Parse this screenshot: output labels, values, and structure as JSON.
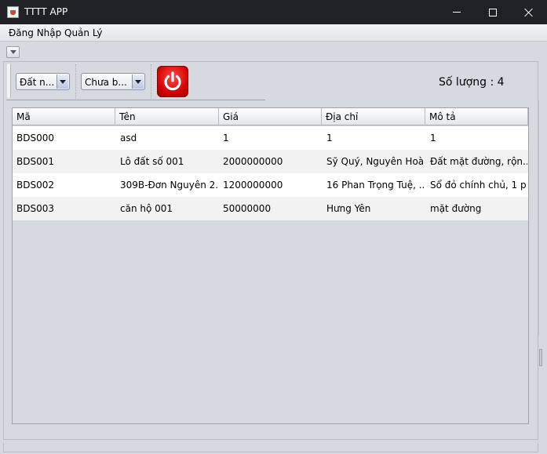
{
  "window": {
    "title": "TTTT APP"
  },
  "menu": {
    "items": [
      "Đăng Nhập",
      "Quản Lý"
    ]
  },
  "toolbar": {
    "combo_type_value": "Đất n...",
    "combo_status_value": "Chưa b...",
    "count_label": "Số lượng : 4"
  },
  "table": {
    "columns": [
      "Mã",
      "Tên",
      "Giá",
      "Địa chỉ",
      "Mô tả"
    ],
    "rows": [
      [
        "BDS000",
        "asd",
        "1",
        "1",
        "1"
      ],
      [
        "BDS001",
        "Lô đất số 001",
        "2000000000",
        "Sỹ Quý, Nguyên Hoà...",
        "Đất mặt đường, rộn..."
      ],
      [
        "BDS002",
        "309B-Đơn Nguyên 2...",
        "1200000000",
        "16 Phan Trọng Tuệ, ...",
        "Sổ đỏ chính chủ, 1 p..."
      ],
      [
        "BDS003",
        "căn hộ 001",
        "50000000",
        "Hưng Yên",
        "mặt đường"
      ]
    ]
  },
  "colors": {
    "titlebar": "#202124",
    "power_button": "#d40000"
  }
}
